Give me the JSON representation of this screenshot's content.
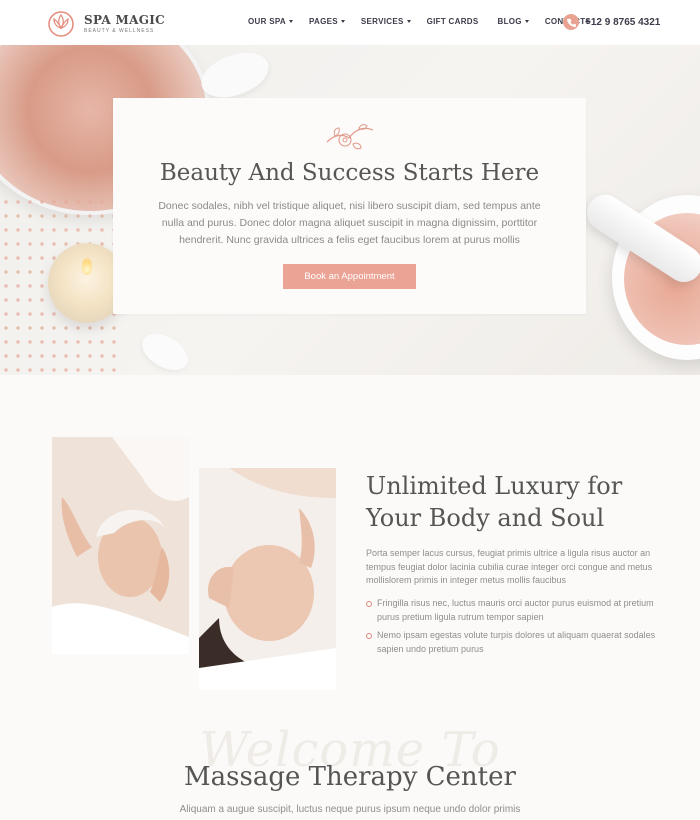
{
  "brand": {
    "name": "SPA MAGIC",
    "tagline": "BEAUTY & WELLNESS",
    "accent_color": "#eba395",
    "logo_icon": "lotus-icon"
  },
  "nav": {
    "items": [
      {
        "label": "OUR SPA",
        "dropdown": true
      },
      {
        "label": "PAGES",
        "dropdown": true
      },
      {
        "label": "SERVICES",
        "dropdown": true
      },
      {
        "label": "GIFT CARDS",
        "dropdown": false
      },
      {
        "label": "BLOG",
        "dropdown": true
      },
      {
        "label": "CONTACTS",
        "dropdown": false
      }
    ],
    "phone": "+12 9 8765 4321",
    "phone_icon": "phone-icon"
  },
  "hero": {
    "ornament_icon": "floral-ornament-icon",
    "title": "Beauty And Success Starts Here",
    "text": "Donec sodales, nibh vel tristique aliquet, nisi libero suscipit diam, sed tempus ante nulla and purus. Donec dolor magna aliquet suscipit in magna dignissim, porttitor hendrerit. Nunc gravida ultrices a felis eget faucibus lorem at purus mollis",
    "button": "Book an Appointment"
  },
  "luxury": {
    "title": "Unlimited Luxury for Your Body and Soul",
    "text": "Porta semper lacus cursus, feugiat primis ultrice a ligula risus auctor an tempus feugiat dolor lacinia cubilia curae integer orci congue and metus mollislorem primis in integer metus mollis faucibus",
    "list": [
      "Fringilla risus nec, luctus mauris orci auctor purus euismod at pretium purus pretium ligula rutrum tempor sapien",
      "Nemo ipsam egestas volute turpis dolores ut aliquam quaerat sodales sapien undo pretium purus"
    ]
  },
  "massage": {
    "script": "Welcome To",
    "title": "Massage Therapy Center",
    "subtitle": "Aliquam a augue suscipit, luctus neque purus ipsum neque undo dolor primis"
  }
}
